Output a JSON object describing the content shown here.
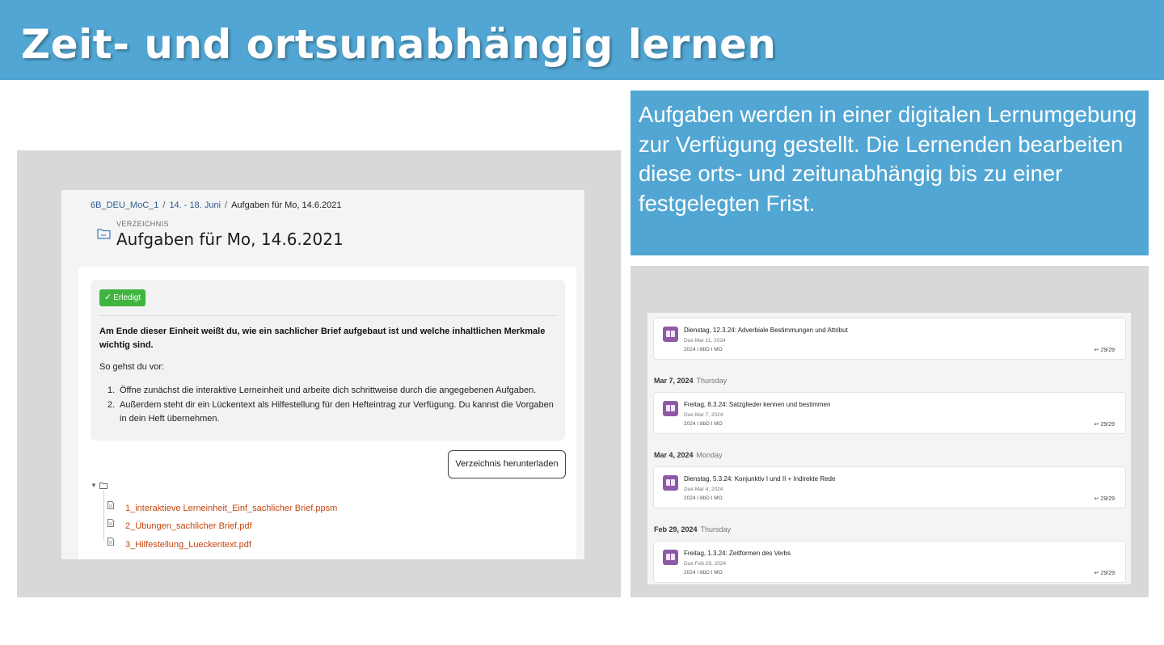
{
  "slide": {
    "title": "Zeit- und ortsunabhängig lernen",
    "info_text": "Aufgaben werden in einer digitalen Lernumgebung zur Verfügung gestellt. Die Lernenden bearbeiten diese orts- und zeitunabhängig bis zu einer festgelegten Frist."
  },
  "moodle": {
    "breadcrumb": [
      "6B_DEU_MoC_1",
      "14. - 18. Juni",
      "Aufgaben für Mo, 14.6.2021"
    ],
    "kicker": "VERZEICHNIS",
    "heading": "Aufgaben für Mo, 14.6.2021",
    "badge": "Erledigt",
    "goal": "Am Ende dieser Einheit weißt du, wie ein sachlicher Brief aufgebaut ist und welche inhaltlichen Merkmale wichtig sind.",
    "howto": "So gehst du vor:",
    "steps": [
      "Öffne zunächst die interaktive Lerneinheit und arbeite dich schrittweise durch die angegebenen Aufgaben.",
      "Außerdem steht dir ein Lückentext als Hilfestellung für den Hefteintrag zur Verfügung. Du kannst die Vorgaben in dein Heft übernehmen."
    ],
    "download_label": "Verzeichnis herunterladen",
    "files": [
      "1_interaktieve Lerneinheit_Einf_sachlicher Brief.ppsm",
      "2_Übungen_sachlicher Brief.pdf",
      "3_Hilfestellung_Lueckentext.pdf"
    ]
  },
  "teams": {
    "assignments": [
      {
        "title": "Dienstag, 12.3.24: Adverbiale Bestimmungen und Attribut",
        "due": "Due Mar 11, 2024",
        "class": "2024 I 8bD I MO",
        "count": "29/29"
      },
      {
        "date": "Mar 7, 2024",
        "weekday": "Thursday",
        "title": "Freitag, 8.3.24: Satzglieder kennen und bestimmen",
        "due": "Due Mar 7, 2024",
        "class": "2024 I 8bD I MO",
        "count": "29/29"
      },
      {
        "date": "Mar 4, 2024",
        "weekday": "Monday",
        "title": "Dienstag, 5.3.24: Konjunktiv I und II + Indirekte Rede",
        "due": "Due Mar 4, 2024",
        "class": "2024 I 8bD I MO",
        "count": "29/29"
      },
      {
        "date": "Feb 29, 2024",
        "weekday": "Thursday",
        "title": "Freitag, 1.3.24: Zeitformen des Verbs",
        "due": "Due Feb 29, 2024",
        "class": "2024 I 8bD I MO",
        "count": "29/29"
      }
    ],
    "icon_color": "#8e5aa6"
  },
  "colors": {
    "header_bg": "#52a6d3",
    "info_bg": "#52a6d3",
    "badge": "#3fb53f",
    "file_link": "#c4440d",
    "breadcrumb_link": "#2b5b8f"
  }
}
